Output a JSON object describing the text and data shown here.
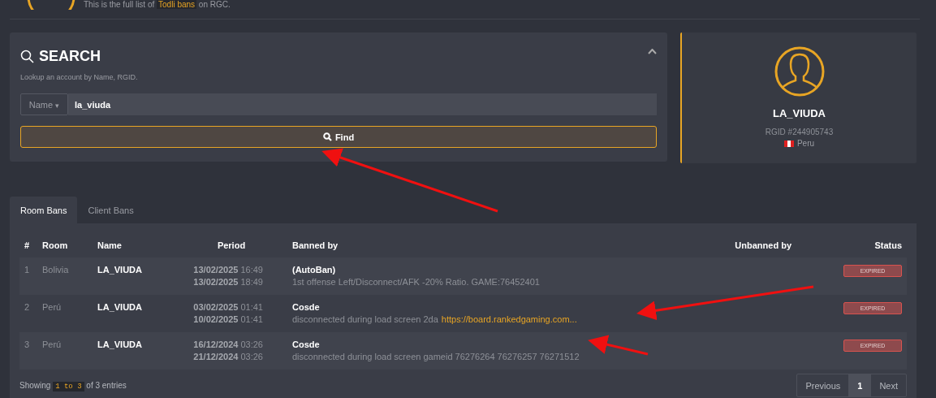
{
  "header": {
    "subtitle_before": "This is the full list of",
    "subtitle_badge": "Todli bans",
    "subtitle_after": "on RGC."
  },
  "search": {
    "title": "SEARCH",
    "hint": "Lookup an account by Name, RGID.",
    "field_type": "Name",
    "field_caret": "▾",
    "value": "la_viuda",
    "button": "Find"
  },
  "profile": {
    "name": "LA_VIUDA",
    "rgid": "RGID #244905743",
    "country": "Peru"
  },
  "tabs": [
    {
      "label": "Room Bans",
      "selected": true
    },
    {
      "label": "Client Bans",
      "selected": false
    }
  ],
  "table": {
    "columns": [
      "#",
      "Room",
      "Name",
      "Period",
      "Banned by",
      "Unbanned by",
      "Status"
    ],
    "rows": [
      {
        "index": "1",
        "room": "Bolivia",
        "name": "LA_VIUDA",
        "start_date": "13/02/2025",
        "start_time": "16:49",
        "end_date": "13/02/2025",
        "end_time": "18:49",
        "banned_by": "(AutoBan)",
        "reason": "1st offense Left/Disconnect/AFK -20% Ratio. GAME:76452401",
        "status": "EXPIRED"
      },
      {
        "index": "2",
        "room": "Perú",
        "name": "LA_VIUDA",
        "start_date": "03/02/2025",
        "start_time": "01:41",
        "end_date": "10/02/2025",
        "end_time": "01:41",
        "banned_by": "Cosde",
        "reason": "disconnected during load screen 2da",
        "link": "https://board.rankedgaming.com...",
        "status": "EXPIRED"
      },
      {
        "index": "3",
        "room": "Perú",
        "name": "LA_VIUDA",
        "start_date": "16/12/2024",
        "start_time": "03:26",
        "end_date": "21/12/2024",
        "end_time": "03:26",
        "banned_by": "Cosde",
        "reason": "disconnected during load screen gameid 76276264 76276257 76271512",
        "status": "EXPIRED"
      }
    ]
  },
  "footer": {
    "showing_before": "Showing",
    "showing_range": "1 to 3",
    "showing_after": "of 3 entries"
  },
  "pagination": [
    {
      "label": "Previous",
      "kind": "nav",
      "selected": false
    },
    {
      "label": "1",
      "kind": "page",
      "selected": true
    },
    {
      "label": "Next",
      "kind": "nav",
      "selected": false
    }
  ]
}
